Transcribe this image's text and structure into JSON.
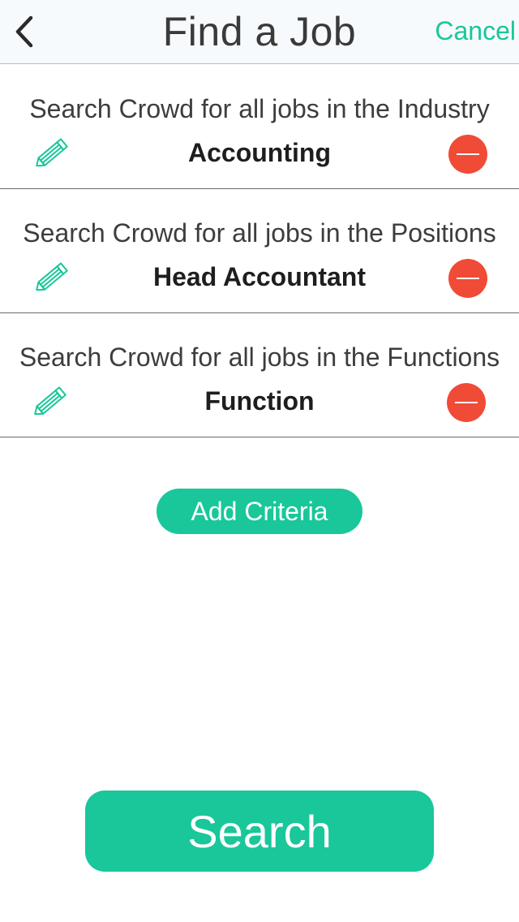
{
  "navbar": {
    "title": "Find a Job",
    "cancel_label": "Cancel",
    "back_icon": "chevron-left-icon"
  },
  "criteria": [
    {
      "description": "Search Crowd for all jobs in the Industry",
      "value": "Accounting",
      "edit_icon": "pencil-icon",
      "remove_icon": "minus-circle-icon"
    },
    {
      "description": "Search Crowd for all jobs in the Positions",
      "value": "Head Accountant",
      "edit_icon": "pencil-icon",
      "remove_icon": "minus-circle-icon"
    },
    {
      "description": "Search Crowd for all jobs in the Functions",
      "value": "Function",
      "edit_icon": "pencil-icon",
      "remove_icon": "minus-circle-icon"
    }
  ],
  "add_criteria_label": "Add Criteria",
  "search_label": "Search",
  "colors": {
    "accent": "#19c79a",
    "remove": "#f04b36",
    "navbar_bg": "#f7fafc"
  }
}
